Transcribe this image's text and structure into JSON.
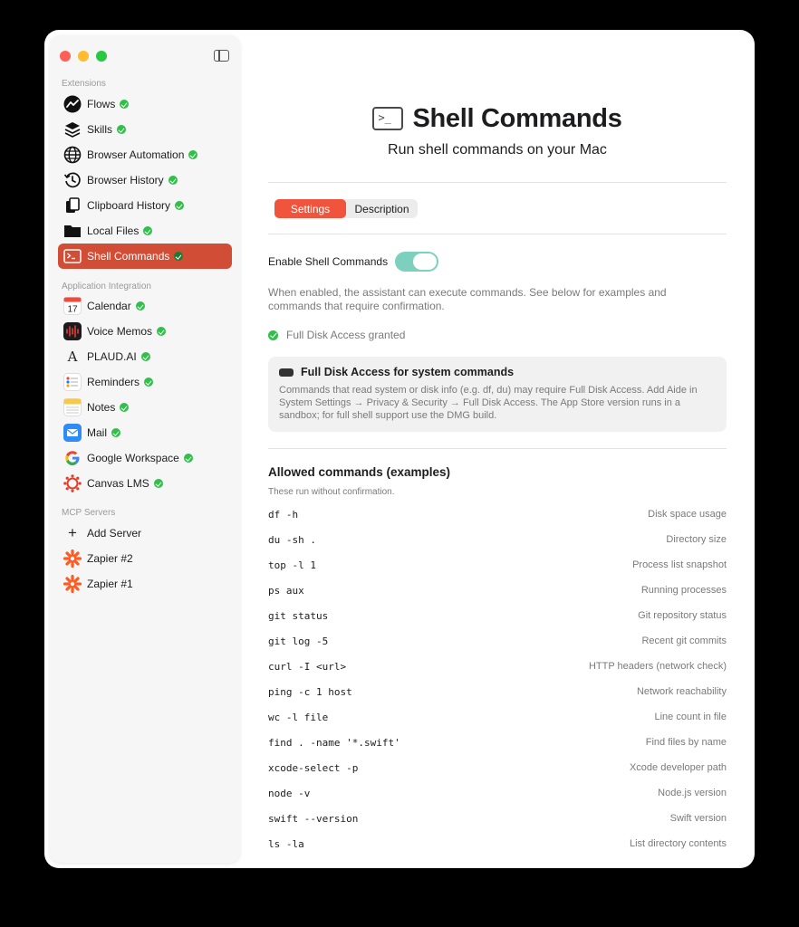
{
  "sidebar": {
    "sections": {
      "extensions": "Extensions",
      "app_integration": "Application Integration",
      "mcp": "MCP Servers"
    },
    "extensions": [
      {
        "label": "Flows",
        "icon": "flows-icon"
      },
      {
        "label": "Skills",
        "icon": "layers-icon"
      },
      {
        "label": "Browser Automation",
        "icon": "globe-icon"
      },
      {
        "label": "Browser History",
        "icon": "history-icon"
      },
      {
        "label": "Clipboard History",
        "icon": "clipboard-icon"
      },
      {
        "label": "Local Files",
        "icon": "folder-icon"
      },
      {
        "label": "Shell Commands",
        "icon": "terminal-icon"
      }
    ],
    "apps": [
      {
        "label": "Calendar",
        "icon": "calendar-icon",
        "day": "17"
      },
      {
        "label": "Voice Memos",
        "icon": "voice-memos-icon"
      },
      {
        "label": "PLAUD.AI",
        "icon": "plaud-icon",
        "glyph": "A"
      },
      {
        "label": "Reminders",
        "icon": "reminders-icon"
      },
      {
        "label": "Notes",
        "icon": "notes-icon"
      },
      {
        "label": "Mail",
        "icon": "mail-icon"
      },
      {
        "label": "Google Workspace",
        "icon": "google-icon",
        "glyph": "G"
      },
      {
        "label": "Canvas LMS",
        "icon": "canvas-icon"
      }
    ],
    "mcp": [
      {
        "label": "Add Server",
        "icon": "plus-icon",
        "glyph": "+"
      },
      {
        "label": "Zapier #2",
        "icon": "zapier-icon"
      },
      {
        "label": "Zapier #1",
        "icon": "zapier-icon"
      }
    ]
  },
  "header": {
    "title": "Shell Commands",
    "subtitle": "Run shell commands on your Mac",
    "title_glyph": ">_"
  },
  "tabs": [
    "Settings",
    "Description"
  ],
  "settings": {
    "toggle_label": "Enable Shell Commands",
    "toggle_on": true,
    "description": "When enabled, the assistant can execute commands. See below for examples and commands that require confirmation.",
    "granted": "Full Disk Access granted",
    "info_title": "Full Disk Access for system commands",
    "info_body": "Commands that read system or disk info (e.g. df, du) may require Full Disk Access. Add Aide in System Settings → Privacy & Security → Full Disk Access. The App Store version runs in a sandbox; for full shell support use the DMG build."
  },
  "allowed": {
    "title": "Allowed commands (examples)",
    "subtitle": "These run without confirmation.",
    "commands": [
      {
        "cmd": "df -h",
        "desc": "Disk space usage"
      },
      {
        "cmd": "du -sh .",
        "desc": "Directory size"
      },
      {
        "cmd": "top -l 1",
        "desc": "Process list snapshot"
      },
      {
        "cmd": "ps aux",
        "desc": "Running processes"
      },
      {
        "cmd": "git status",
        "desc": "Git repository status"
      },
      {
        "cmd": "git log -5",
        "desc": "Recent git commits"
      },
      {
        "cmd": "curl -I <url>",
        "desc": "HTTP headers (network check)"
      },
      {
        "cmd": "ping -c 1 host",
        "desc": "Network reachability"
      },
      {
        "cmd": "wc -l file",
        "desc": "Line count in file"
      },
      {
        "cmd": "find . -name '*.swift'",
        "desc": "Find files by name"
      },
      {
        "cmd": "xcode-select -p",
        "desc": "Xcode developer path"
      },
      {
        "cmd": "node -v",
        "desc": "Node.js version"
      },
      {
        "cmd": "swift --version",
        "desc": "Swift version"
      },
      {
        "cmd": "ls -la",
        "desc": "List directory contents"
      }
    ]
  },
  "colors": {
    "accent": "#f0543c",
    "active_item": "#d24d36",
    "status_green": "#30c04a",
    "toggle_on": "#7dd0be"
  }
}
